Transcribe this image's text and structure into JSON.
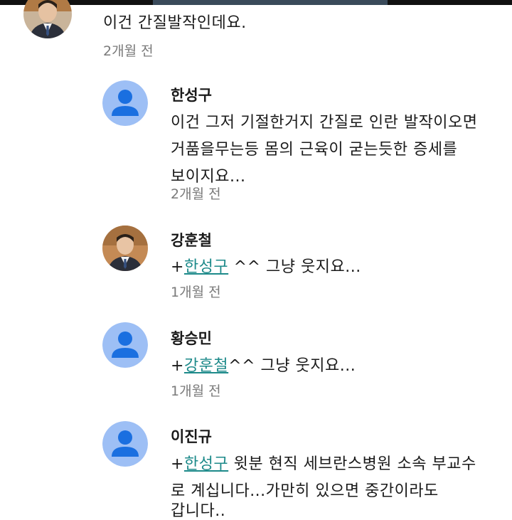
{
  "main_comment": {
    "text": "이건 간질발작인데요.",
    "time": "2개월 전"
  },
  "replies": [
    {
      "author": "한성구",
      "lines": [
        "이건 그저 기절한거지 간질로 인란 발작이오면",
        "거품을무는등 몸의 근육이 굳는듯한 증세를",
        "보이지요..."
      ],
      "time": "2개월 전",
      "avatar": "default"
    },
    {
      "author": "강훈철",
      "mention_prefix": "+",
      "mention": "한성구",
      "text_after_mention": " ^^ 그냥 웃지요...",
      "time": "1개월 전",
      "avatar": "photo"
    },
    {
      "author": "황승민",
      "mention_prefix": "+",
      "mention": "강훈철",
      "text_after_mention": "^^ 그냥 웃지요...",
      "time": "1개월 전",
      "avatar": "default"
    },
    {
      "author": "이진규",
      "mention_prefix": "+",
      "mention": "한성구",
      "text_after_mention": " 윗분 현직 세브란스병원 소속 부교수",
      "lines": [
        "로 계십니다...가만히 있으면 중간이라도",
        "갑니다.."
      ],
      "time": "",
      "avatar": "default"
    }
  ],
  "colors": {
    "mention": "#1d8a8a",
    "default_avatar_bg": "#9dbff5",
    "default_avatar_fg": "#1a6fe0",
    "timestamp": "#7a7a7a"
  },
  "icons": {
    "default_avatar": "person-silhouette-icon",
    "photo_avatar": "profile-photo"
  }
}
